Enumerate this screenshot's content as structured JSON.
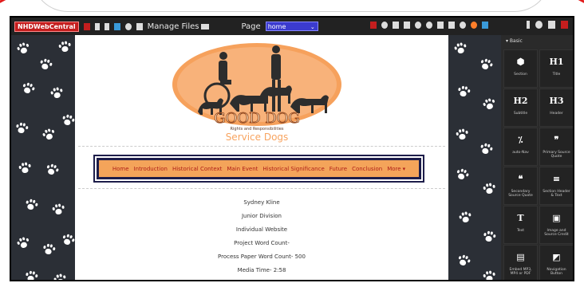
{
  "toolbar": {
    "logo": "NHDWebCentral",
    "manage_files": "Manage Files",
    "page_label": "Page",
    "page_select_value": "home"
  },
  "logo": {
    "title_line1": "GOOD DOG",
    "title_line2": "Rights and Responsibilities",
    "title_line3": "Service Dogs"
  },
  "nav": {
    "items": [
      "Home",
      "Introduction",
      "Historical Context",
      "Main Event",
      "Historical Significance",
      "Future",
      "Conclusion",
      "More"
    ]
  },
  "content": {
    "lines": [
      "Sydney Kline",
      "Junior Division",
      "Individual Website",
      "Project Word Count-",
      "Process Paper Word Count- 500",
      "Media Time- 2:58"
    ]
  },
  "sidebar": {
    "category": "Basic",
    "tiles": [
      {
        "icon": "box-icon",
        "glyph": "⬢",
        "label": "Section"
      },
      {
        "icon": "h1-icon",
        "glyph": "H1",
        "label": "Title"
      },
      {
        "icon": "h2-icon",
        "glyph": "H2",
        "label": "Subtitle"
      },
      {
        "icon": "h3-icon",
        "glyph": "H3",
        "label": "Header"
      },
      {
        "icon": "percent-icon",
        "glyph": "⁒",
        "label": "auto-Nav"
      },
      {
        "icon": "quote-icon",
        "glyph": "❞",
        "label": "Primary Source Quote"
      },
      {
        "icon": "quote-open-icon",
        "glyph": "❝",
        "label": "Secondary Source Quote"
      },
      {
        "icon": "lines-icon",
        "glyph": "≡",
        "label": "Section Header & Text"
      },
      {
        "icon": "text-icon",
        "glyph": "T",
        "label": "Text"
      },
      {
        "icon": "image-icon",
        "glyph": "▣",
        "label": "Image and Source Credit"
      },
      {
        "icon": "file-icon",
        "glyph": "▤",
        "label": "Embed MP3, MP4 or PDF"
      },
      {
        "icon": "nav-button-icon",
        "glyph": "◩",
        "label": "Navigation Button"
      }
    ]
  },
  "colors": {
    "nav_bg": "#f4a45a",
    "nav_text": "#b0201a",
    "brand_red": "#c41e1e",
    "page_bg": "#2b2f36"
  }
}
